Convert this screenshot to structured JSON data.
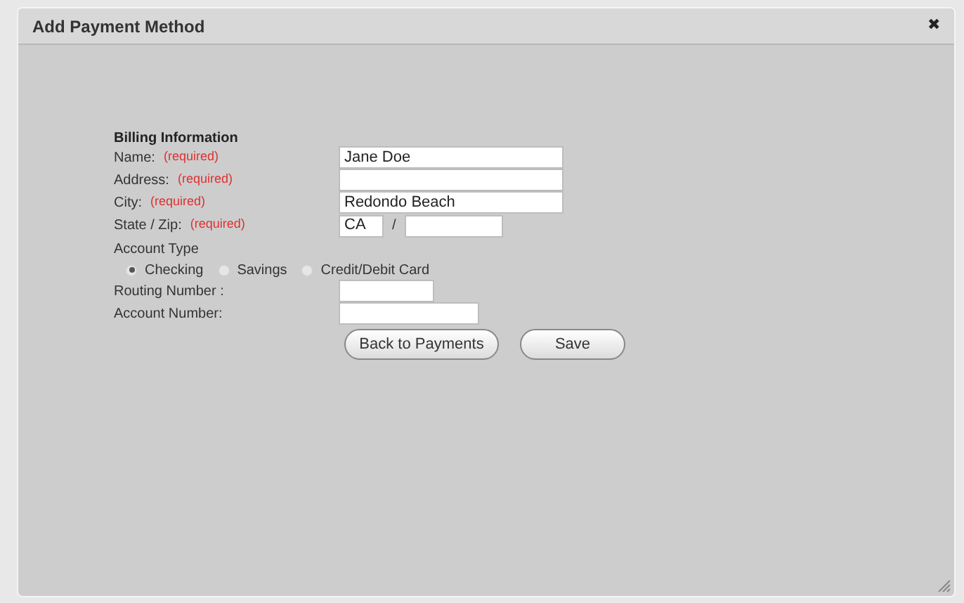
{
  "dialog": {
    "title": "Add Payment Method",
    "close": "✖"
  },
  "section_title": "Billing Information",
  "fields": [
    {
      "label": "Name:",
      "required": "(required)",
      "value": "Jane Doe"
    },
    {
      "label": "Address:",
      "required": "(required)"
    },
    {
      "label": "City:",
      "required": "(required)",
      "value": "Redondo Beach"
    }
  ],
  "state_zip": {
    "label": "State / Zip:",
    "required": "(required)",
    "state": "CA",
    "separator": "/"
  },
  "account_type": {
    "label": "Account Type",
    "options": [
      {
        "label": "Checking",
        "selected": true
      },
      {
        "label": "Savings",
        "selected": false
      },
      {
        "label": "Credit/Debit Card",
        "selected": false
      }
    ]
  },
  "account_fields": [
    {
      "label": "Routing Number :"
    },
    {
      "label": "Account Number:"
    }
  ],
  "buttons": [
    {
      "label": "Back to Payments"
    },
    {
      "label": "Save"
    }
  ]
}
